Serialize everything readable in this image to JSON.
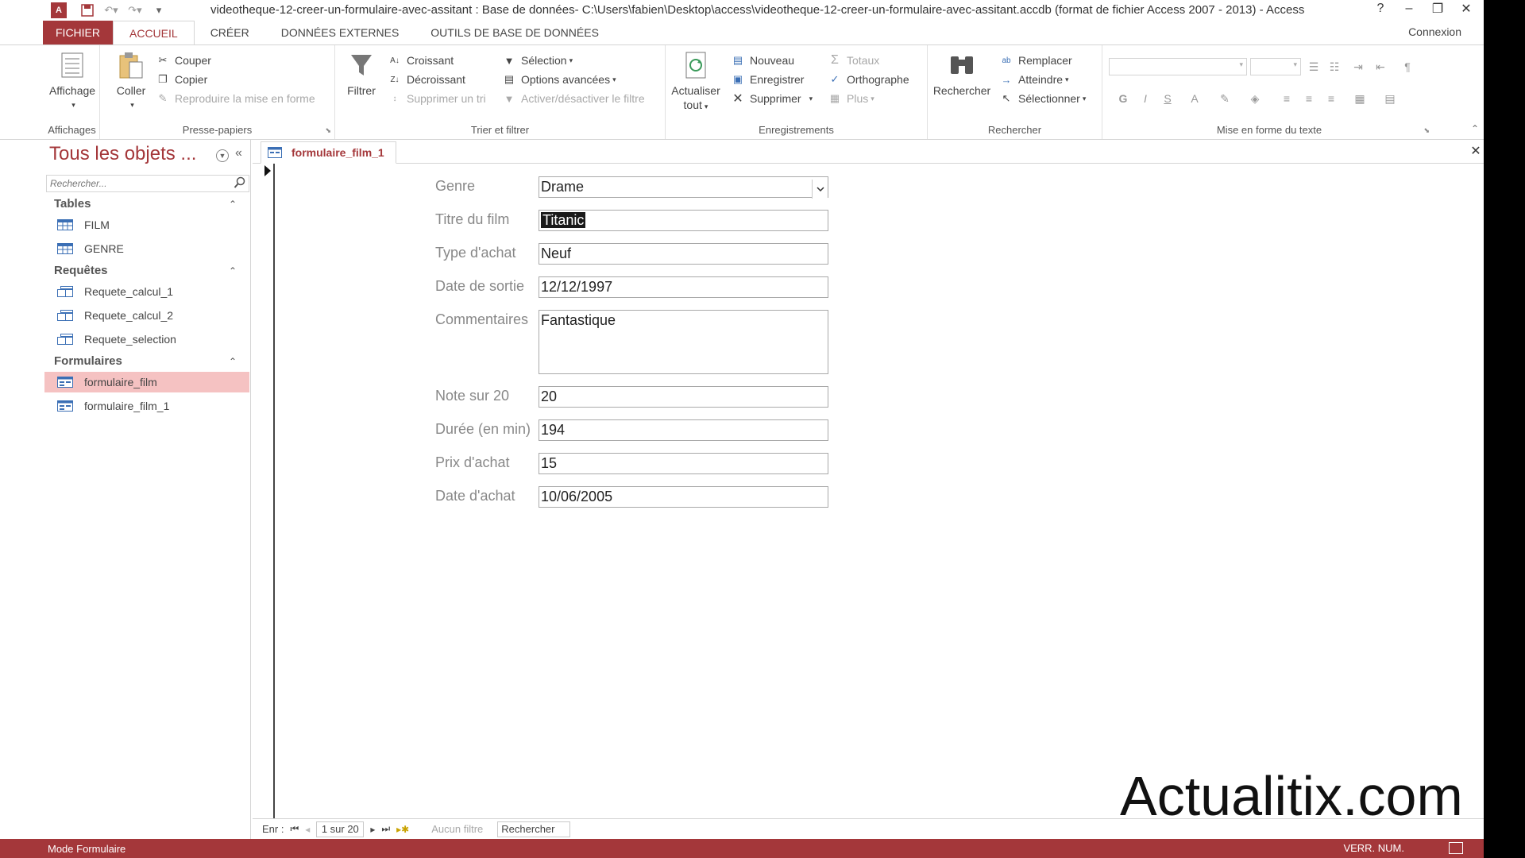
{
  "titlebar": {
    "title": "videotheque-12-creer-un-formulaire-avec-assitant : Base de données- C:\\Users\\fabien\\Desktop\\access\\videotheque-12-creer-un-formulaire-avec-assitant.accdb (format de fichier Access 2007 - 2013) - Access",
    "help": "?",
    "app_logo": "A"
  },
  "tabs": {
    "file": "FICHIER",
    "home": "ACCUEIL",
    "create": "CRÉER",
    "external": "DONNÉES EXTERNES",
    "dbtools": "OUTILS DE BASE DE DONNÉES",
    "connexion": "Connexion"
  },
  "ribbon": {
    "views": {
      "btn": "Affichage",
      "label": "Affichages"
    },
    "clipboard": {
      "paste": "Coller",
      "cut": "Couper",
      "copy": "Copier",
      "format_painter": "Reproduire la mise en forme",
      "label": "Presse-papiers"
    },
    "sort_filter": {
      "filter": "Filtrer",
      "ascending": "Croissant",
      "descending": "Décroissant",
      "remove_sort": "Supprimer un tri",
      "selection": "Sélection",
      "advanced": "Options avancées",
      "toggle_filter": "Activer/désactiver le filtre",
      "label": "Trier et filtrer"
    },
    "records": {
      "refresh_line1": "Actualiser",
      "refresh_line2": "tout",
      "new": "Nouveau",
      "save": "Enregistrer",
      "delete": "Supprimer",
      "totals": "Totaux",
      "spelling": "Orthographe",
      "more": "Plus",
      "label": "Enregistrements"
    },
    "find": {
      "find": "Rechercher",
      "replace": "Remplacer",
      "goto": "Atteindre",
      "select": "Sélectionner",
      "label": "Rechercher"
    },
    "text_format": {
      "bold": "G",
      "italic": "I",
      "underline": "S",
      "font_color": "A",
      "label": "Mise en forme du texte"
    }
  },
  "nav": {
    "title": "Tous les objets ...",
    "search_placeholder": "Rechercher...",
    "sections": [
      {
        "title": "Tables",
        "items": [
          "FILM",
          "GENRE"
        ]
      },
      {
        "title": "Requêtes",
        "items": [
          "Requete_calcul_1",
          "Requete_calcul_2",
          "Requete_selection"
        ]
      },
      {
        "title": "Formulaires",
        "items": [
          "formulaire_film",
          "formulaire_film_1"
        ]
      }
    ]
  },
  "document": {
    "tab_title": "formulaire_film_1",
    "fields": [
      {
        "label": "Genre",
        "value": "Drame"
      },
      {
        "label": "Titre du film",
        "value": "Titanic"
      },
      {
        "label": "Type d'achat",
        "value": "Neuf"
      },
      {
        "label": "Date de sortie",
        "value": "12/12/1997"
      },
      {
        "label": "Commentaires",
        "value": "Fantastique"
      },
      {
        "label": "Note sur 20",
        "value": "20"
      },
      {
        "label": "Durée (en min)",
        "value": "194"
      },
      {
        "label": "Prix d'achat",
        "value": "15"
      },
      {
        "label": "Date d'achat",
        "value": "10/06/2005"
      }
    ]
  },
  "record_nav": {
    "label": "Enr :",
    "position": "1 sur 20",
    "filter": "Aucun filtre",
    "search": "Rechercher"
  },
  "watermark": "Actualitix.com",
  "status": {
    "mode": "Mode Formulaire",
    "numlock": "VERR. NUM."
  },
  "colors": {
    "accent": "#a4373a",
    "selected_nav": "#f5c2c2"
  }
}
